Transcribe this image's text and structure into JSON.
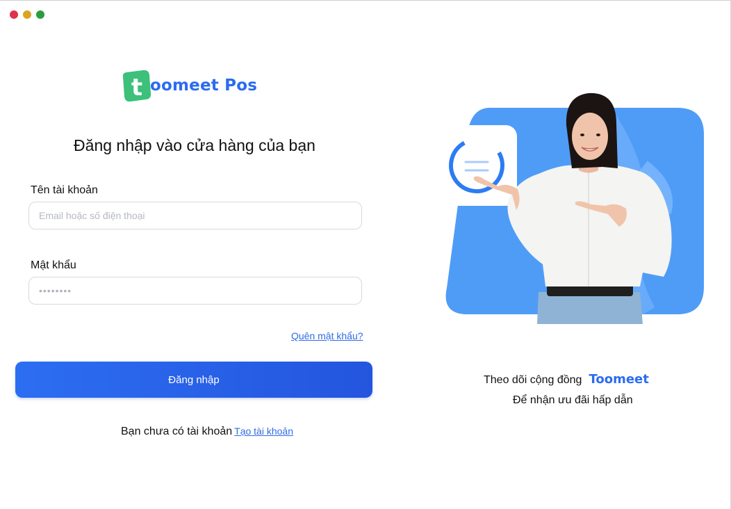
{
  "window": {
    "controls": [
      {
        "name": "close",
        "color": "#e0324e"
      },
      {
        "name": "minimize",
        "color": "#dba421"
      },
      {
        "name": "maximize",
        "color": "#2a9d3f"
      }
    ]
  },
  "brand": {
    "logo_letter": "t",
    "logo_text": "oomeet Pos",
    "logo_color": "#3cc07a",
    "accent": "#2b6cf0"
  },
  "login": {
    "title": "Đăng nhập vào cửa hàng của bạn",
    "username_label": "Tên tài khoản",
    "username_placeholder": "Email hoặc số điện thoại",
    "username_value": "",
    "password_label": "Mật khẩu",
    "password_placeholder": "••••••••",
    "password_value": "",
    "forgot_link": "Quên mật khẩu?",
    "submit_label": "Đăng nhập",
    "no_account_text": "Bạn chưa có tài khoản",
    "create_account_link": "Tạo tài khoản"
  },
  "promo": {
    "follow_text": "Theo dõi cộng đồng",
    "community_name": "Toomeet",
    "offer_text": "Để nhận ưu đãi hấp dẫn",
    "hero_bg_color": "#4f9cf7"
  }
}
